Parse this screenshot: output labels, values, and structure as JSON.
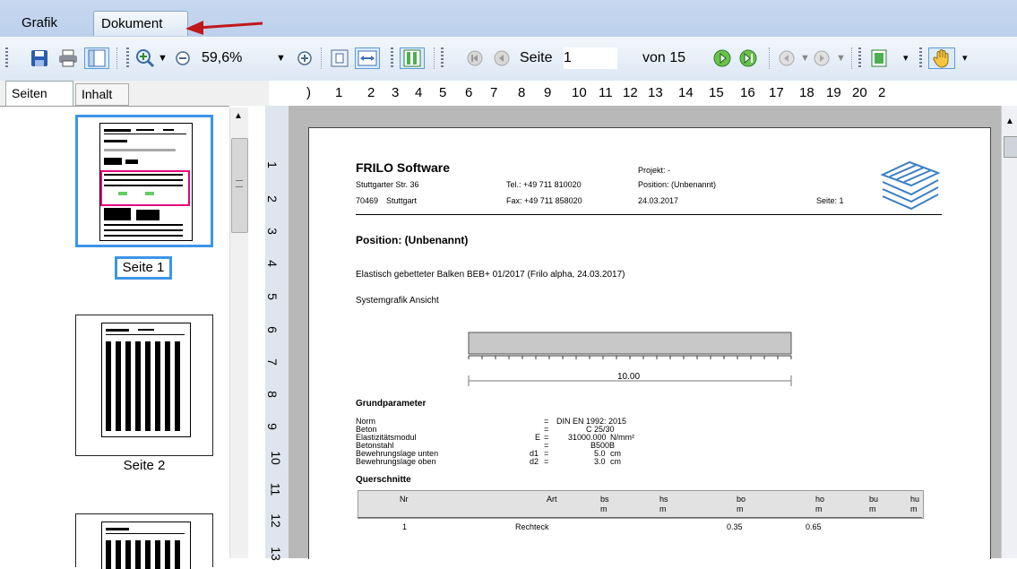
{
  "tabs": {
    "grafik": "Grafik",
    "dokument": "Dokument"
  },
  "toolbar": {
    "zoom": "59,6%",
    "seite_label": "Seite",
    "seite_value": "1",
    "von": "von 15"
  },
  "panel": {
    "tab_seiten": "Seiten",
    "tab_inhalt": "Inhalt"
  },
  "thumbnails": [
    {
      "label": "Seite 1"
    },
    {
      "label": "Seite 2"
    }
  ],
  "hruler": [
    "1",
    "2",
    "3",
    "4",
    "5",
    "6",
    "7",
    "8",
    "9",
    "10",
    "11",
    "12",
    "13",
    "14",
    "15",
    "16",
    "17",
    "18",
    "19",
    "20",
    "2"
  ],
  "vruler": [
    "1",
    "2",
    "3",
    "4",
    "5",
    "6",
    "7",
    "8",
    "9",
    "10",
    "11",
    "12",
    "13"
  ],
  "doc": {
    "company": "FRILO Software",
    "addr1": "Stuttgarter Str. 36",
    "addr2a": "70469",
    "addr2b": "Stuttgart",
    "tel": "Tel.: +49 711 810020",
    "fax": "Fax: +49 711 858020",
    "projekt": "Projekt: -",
    "position_hdr": "Position: (Unbenannt)",
    "date": "24.03.2017",
    "seite": "Seite: 1",
    "position_title": "Position: (Unbenannt)",
    "desc": "Elastisch gebetteter Balken  BEB+ 01/2017 (Frilo alpha, 24.03.2017)",
    "systemgrafik": "Systemgrafik Ansicht",
    "dimension": "10.00",
    "grund_title": "Grundparameter",
    "params": [
      {
        "name": "Norm",
        "sym": "",
        "eq": "=",
        "val": "DIN EN 1992: 2015",
        "unit": ""
      },
      {
        "name": "Beton",
        "sym": "",
        "eq": "=",
        "val": "C 25/30",
        "unit": ""
      },
      {
        "name": "Elastizitätsmodul",
        "sym": "E",
        "eq": "=",
        "val": "31000.000",
        "unit": "N/mm²"
      },
      {
        "name": "Betonstahl",
        "sym": "",
        "eq": "=",
        "val": "B500B",
        "unit": ""
      },
      {
        "name": "Bewehrungslage unten",
        "sym": "d1",
        "eq": "=",
        "val": "5.0",
        "unit": "cm"
      },
      {
        "name": "Bewehrungslage oben",
        "sym": "d2",
        "eq": "=",
        "val": "3.0",
        "unit": "cm"
      }
    ],
    "quer_title": "Querschnitte",
    "table_headers": [
      {
        "h": "Nr",
        "u": ""
      },
      {
        "h": "Art",
        "u": ""
      },
      {
        "h": "bs",
        "u": "m"
      },
      {
        "h": "hs",
        "u": "m"
      },
      {
        "h": "bo",
        "u": "m"
      },
      {
        "h": "ho",
        "u": "m"
      },
      {
        "h": "bu",
        "u": "m"
      },
      {
        "h": "hu",
        "u": "m"
      }
    ],
    "table_row": {
      "nr": "1",
      "art": "Rechteck",
      "bo": "0.35",
      "ho": "0.65"
    }
  }
}
